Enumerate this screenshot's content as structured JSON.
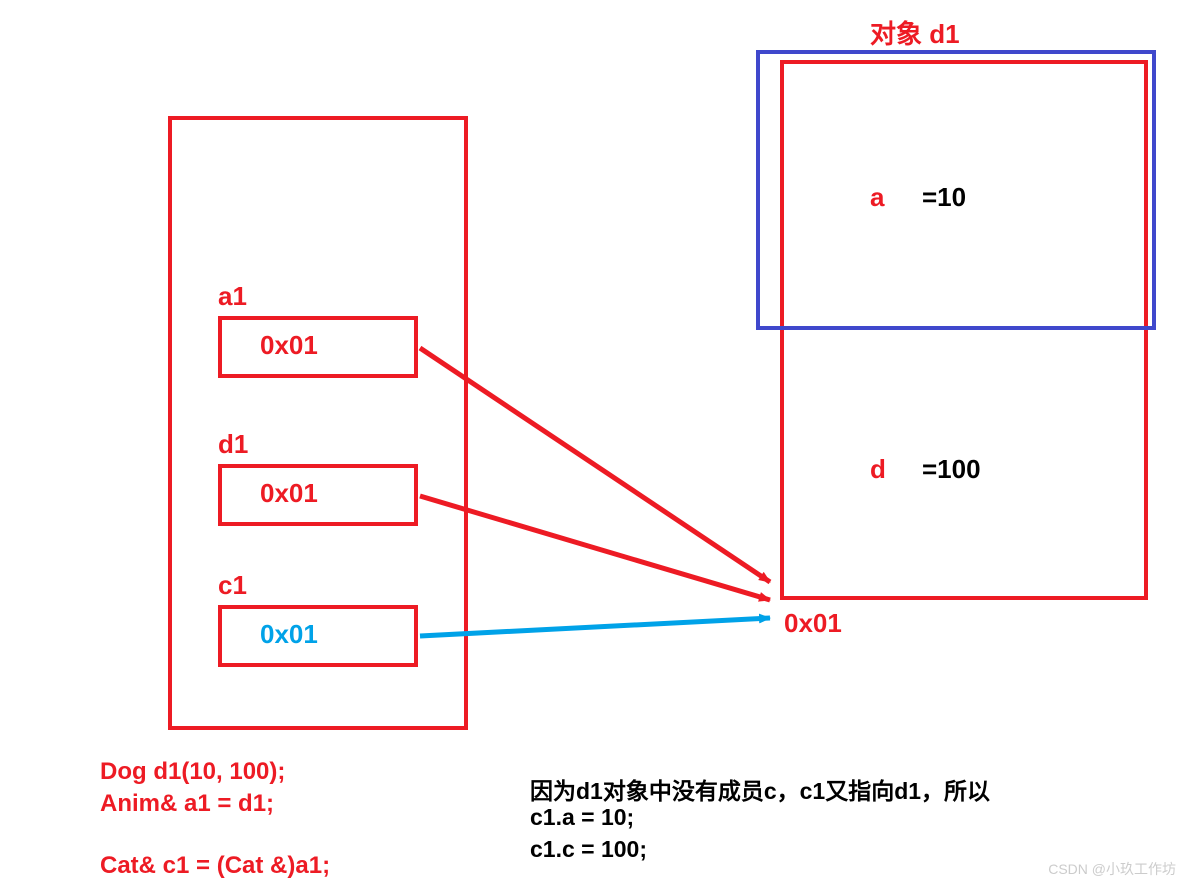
{
  "title": "对象 d1",
  "left_container": {
    "label_a1": "a1",
    "value_a1": "0x01",
    "label_d1": "d1",
    "value_d1": "0x01",
    "label_c1": "c1",
    "value_c1": "0x01"
  },
  "right_object": {
    "member_a_name": "a",
    "member_a_value": "=10",
    "member_d_name": "d",
    "member_d_value": "=100",
    "address_label": "0x01"
  },
  "code": {
    "line1": "Dog d1(10, 100);",
    "line2": "Anim& a1 = d1;",
    "line3": "Cat& c1 = (Cat &)a1;"
  },
  "explanation": {
    "line1": "因为d1对象中没有成员c，c1又指向d1，所以",
    "line2": "c1.a = 10;",
    "line3": "c1.c = 100;"
  },
  "watermark": "CSDN @小玖工作坊"
}
